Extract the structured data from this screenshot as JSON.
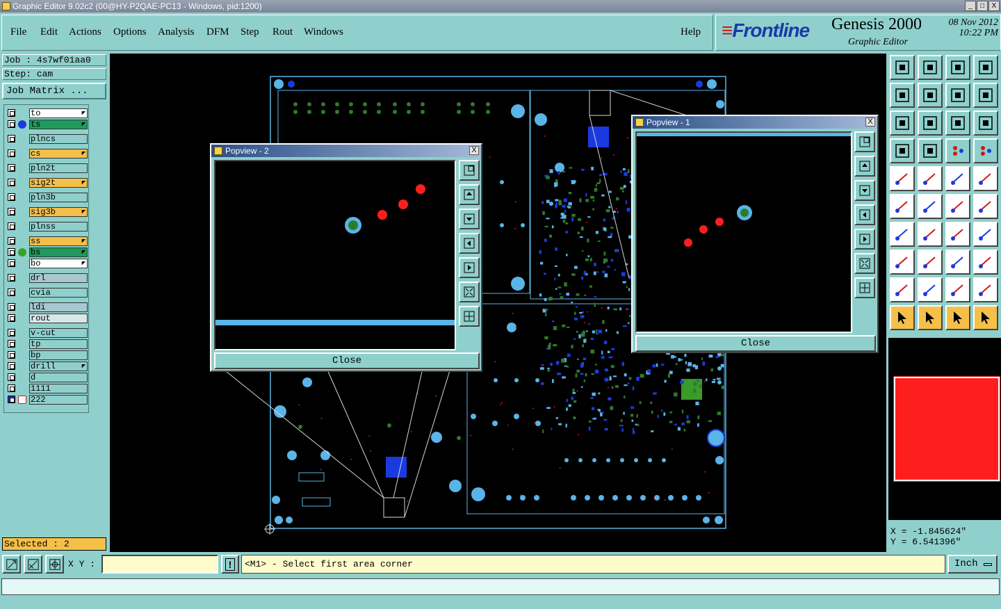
{
  "window": {
    "title": "Graphic Editor 9.02c2 (00@HY-P2QAE-PC13 - Windows, pid:1200)",
    "min": "_",
    "max": "□",
    "close": "X"
  },
  "menu": {
    "file": "File",
    "edit": "Edit",
    "actions": "Actions",
    "options": "Options",
    "analysis": "Analysis",
    "dfm": "DFM",
    "step": "Step",
    "rout": "Rout",
    "windows": "Windows",
    "help": "Help"
  },
  "brand": {
    "logo": "Frontline",
    "product": "Genesis 2000",
    "subtitle": "Graphic Editor",
    "date": "08 Nov 2012",
    "time": "10:22 PM"
  },
  "job": {
    "job_label": "Job : 4s7wf01aa0",
    "step_label": "Step: cam",
    "matrix_button": "Job Matrix ..."
  },
  "layers": [
    {
      "name": "to",
      "color": "#ffffff",
      "dot": "",
      "arrow": true
    },
    {
      "name": "ts",
      "color": "#1f9a5c",
      "dot": "#1a3ae0",
      "arrow": true
    },
    {
      "name": "plncs",
      "color": "#8fd0cc",
      "dot": "",
      "arrow": false
    },
    {
      "name": "cs",
      "color": "#f5c04a",
      "dot": "",
      "arrow": true
    },
    {
      "name": "pln2t",
      "color": "#8fd0cc",
      "dot": "",
      "arrow": false
    },
    {
      "name": "sig2t",
      "color": "#f5c04a",
      "dot": "",
      "arrow": true
    },
    {
      "name": "pln3b",
      "color": "#8fd0cc",
      "dot": "",
      "arrow": false
    },
    {
      "name": "sig3b",
      "color": "#f5c04a",
      "dot": "",
      "arrow": true
    },
    {
      "name": "plnss",
      "color": "#8fd0cc",
      "dot": "",
      "arrow": false
    },
    {
      "name": "ss",
      "color": "#f5c04a",
      "dot": "",
      "arrow": true
    },
    {
      "name": "bs",
      "color": "#1f9a5c",
      "dot": "#3aa02a",
      "arrow": true
    },
    {
      "name": "bo",
      "color": "#ffffff",
      "dot": "",
      "arrow": true
    },
    {
      "name": "drl",
      "color": "#a8c8d0",
      "dot": "",
      "arrow": false
    },
    {
      "name": "cvia",
      "color": "#8fd0cc",
      "dot": "",
      "arrow": false
    },
    {
      "name": "ldi",
      "color": "#a8c8d0",
      "dot": "",
      "arrow": false
    },
    {
      "name": "rout",
      "color": "#d8e8e8",
      "dot": "",
      "arrow": false
    },
    {
      "name": "v-cut",
      "color": "#8fd0cc",
      "dot": "",
      "arrow": false
    },
    {
      "name": "tp",
      "color": "#8fd0cc",
      "dot": "",
      "arrow": false
    },
    {
      "name": "bp",
      "color": "#8fd0cc",
      "dot": "",
      "arrow": false
    },
    {
      "name": "drill",
      "color": "#8fd0cc",
      "dot": "",
      "arrow": true
    },
    {
      "name": "d",
      "color": "#8fd0cc",
      "dot": "",
      "arrow": false
    },
    {
      "name": "1111",
      "color": "#8fd0cc",
      "dot": "",
      "arrow": false
    },
    {
      "name": "222",
      "color": "#8fd0cc",
      "dot": "",
      "arrow": false
    }
  ],
  "status": {
    "selected": "Selected : 2"
  },
  "popview2": {
    "title": "Popview - 2",
    "close_label": "Close",
    "x": "X"
  },
  "popview1": {
    "title": "Popview - 1",
    "close_label": "Close",
    "x": "X"
  },
  "coords": {
    "x": "X = -1.845624\"",
    "y": "Y = 6.541396\""
  },
  "bottom": {
    "xy_label": "X Y :",
    "xy_value": "",
    "prompt": "<M1> - Select first area corner",
    "unit": "Inch"
  },
  "colors": {
    "teal": "#8fd0cc",
    "pad_cyan": "#5ab4e8",
    "pad_green": "#2f7a2a",
    "red_select": "#ff1e1e",
    "blue_smd": "#1a3ae0"
  }
}
